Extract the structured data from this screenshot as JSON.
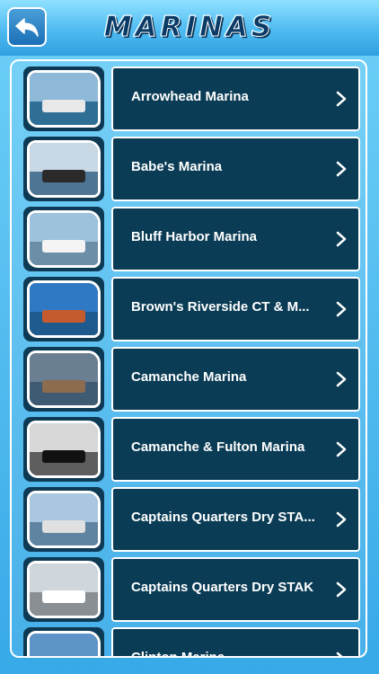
{
  "header": {
    "title": "MARINAS",
    "back_icon": "back-arrow-icon"
  },
  "colors": {
    "title_fill": "#0a3a66",
    "card_bg": "#0a3c55",
    "accent": "#37a9e8"
  },
  "marinas": [
    {
      "label": "Arrowhead Marina",
      "thumb": {
        "sky": "#8fb9d8",
        "water": "#2f6f95",
        "obj": "#e8e8e8"
      }
    },
    {
      "label": "Babe's Marina",
      "thumb": {
        "sky": "#c9d8e5",
        "water": "#4e7593",
        "obj": "#2a2a2a"
      }
    },
    {
      "label": "Bluff Harbor Marina",
      "thumb": {
        "sky": "#9cc2dc",
        "water": "#6c8ea6",
        "obj": "#f4f4f4"
      }
    },
    {
      "label": "Brown's Riverside CT & M...",
      "thumb": {
        "sky": "#2f79c4",
        "water": "#1f5a8f",
        "obj": "#c45a2e"
      }
    },
    {
      "label": "Camanche Marina",
      "thumb": {
        "sky": "#6b7f92",
        "water": "#3f5b73",
        "obj": "#8c6b4f"
      }
    },
    {
      "label": "Camanche & Fulton Marina",
      "thumb": {
        "sky": "#d8d8d8",
        "water": "#5d5d5d",
        "obj": "#111111"
      }
    },
    {
      "label": "Captains Quarters Dry STA...",
      "thumb": {
        "sky": "#a9c7e0",
        "water": "#5e84a2",
        "obj": "#e0e0e0"
      }
    },
    {
      "label": "Captains Quarters Dry STAK",
      "thumb": {
        "sky": "#cfd6dc",
        "water": "#8a8f94",
        "obj": "#ffffff"
      }
    },
    {
      "label": "Clinton Marina",
      "thumb": {
        "sky": "#5d93c6",
        "water": "#3b6f9e",
        "obj": "#d6d6d6"
      }
    }
  ]
}
